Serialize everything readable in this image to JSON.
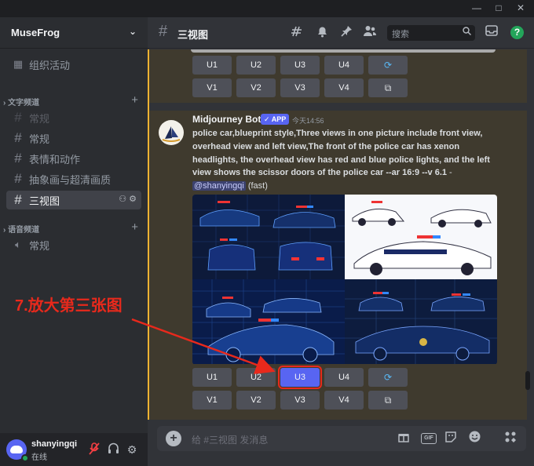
{
  "window": {
    "minimize": "—",
    "maximize": "□",
    "close": "✕"
  },
  "server": {
    "name": "MuseFrog",
    "chevron": "chevron-down-icon"
  },
  "sidebar": {
    "events": {
      "label": "组织活动",
      "icon": "calendar-icon"
    },
    "text_category": "文字频道",
    "text_channels": [
      {
        "label": "常规",
        "state": "muted"
      },
      {
        "label": "常规",
        "state": "normal"
      },
      {
        "label": "表情和动作",
        "state": "normal"
      },
      {
        "label": "抽象画与超清画质",
        "state": "normal"
      },
      {
        "label": "三视图",
        "state": "active"
      }
    ],
    "voice_category": "语音频道",
    "voice_channels": [
      {
        "label": "常规",
        "icon": "speaker-icon"
      }
    ]
  },
  "user": {
    "name": "shanyingqi",
    "status": "在线"
  },
  "channel": {
    "hash": "#",
    "title": "三视图"
  },
  "header_icons": [
    "threads-icon",
    "bell-icon",
    "pin-icon",
    "members-icon"
  ],
  "search": {
    "placeholder": "搜索"
  },
  "buttons": {
    "u": [
      "U1",
      "U2",
      "U3",
      "U4"
    ],
    "v": [
      "V1",
      "V2",
      "V3",
      "V4"
    ]
  },
  "message": {
    "author": "Midjourney Bot",
    "badge": "✓ APP",
    "time": "今天14:56",
    "prompt": "police car,blueprint style,Three views in one picture include front view, overhead view and left view,The front of the police car has xenon headlights, the overhead view has red and blue police lights, and the left view shows the scissor doors of the police car --ar 16:9 --v 6.1",
    "separator": " - ",
    "mention": "@shanyingqi",
    "mode": " (fast)"
  },
  "composer": {
    "placeholder": "给 #三视图 发消息",
    "gif": "GIF"
  },
  "annotation": {
    "text": "7.放大第三张图",
    "color": "#e8291c"
  },
  "colors": {
    "accent": "#5865f2",
    "highlight_border": "#f0b232",
    "online": "#23a55a",
    "annotation": "#e8291c"
  }
}
